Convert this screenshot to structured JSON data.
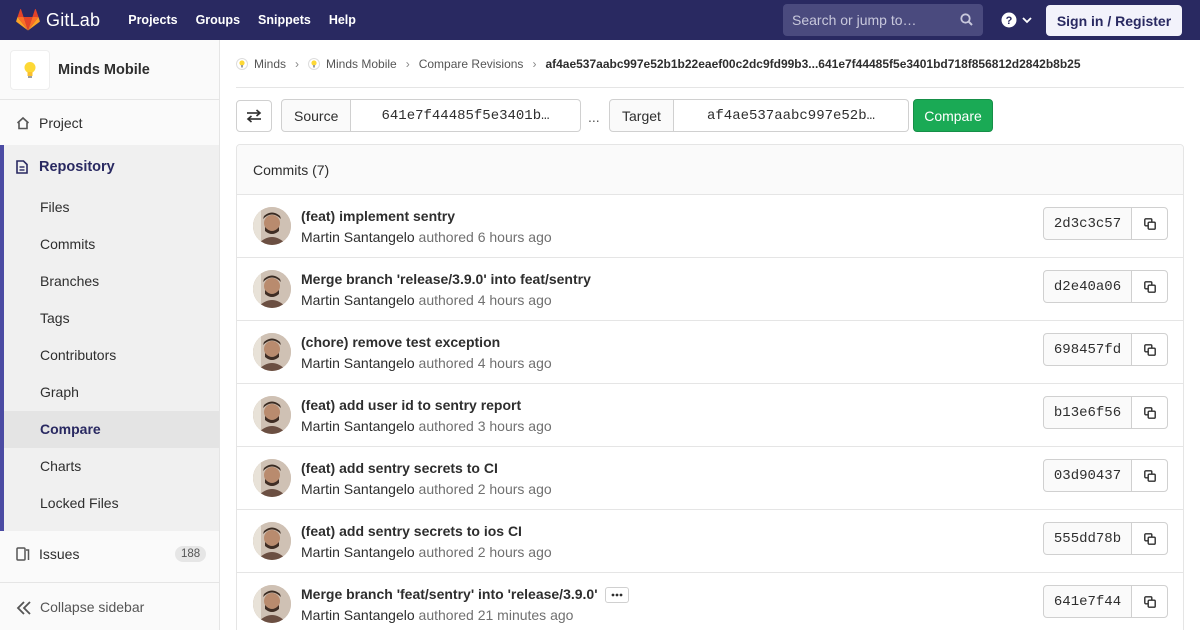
{
  "header": {
    "brand": "GitLab",
    "nav": [
      "Projects",
      "Groups",
      "Snippets",
      "Help"
    ],
    "search_placeholder": "Search or jump to…",
    "signin_label": "Sign in / Register"
  },
  "sidebar": {
    "project_name": "Minds Mobile",
    "project_label": "Project",
    "repository_label": "Repository",
    "repository_items": [
      "Files",
      "Commits",
      "Branches",
      "Tags",
      "Contributors",
      "Graph",
      "Compare",
      "Charts",
      "Locked Files"
    ],
    "active_item": "Compare",
    "issues_label": "Issues",
    "issues_count": "188",
    "collapse_label": "Collapse sidebar"
  },
  "breadcrumb": {
    "items": [
      "Minds",
      "Minds Mobile",
      "Compare Revisions"
    ],
    "current": "af4ae537aabc997e52b1b22eaef00c2dc9fd99b3...641e7f44485f5e3401bd718f856812d2842b8b25"
  },
  "compare": {
    "source_label": "Source",
    "source_value": "641e7f44485f5e3401b…",
    "separator": "...",
    "target_label": "Target",
    "target_value": "af4ae537aabc997e52b…",
    "button_label": "Compare"
  },
  "commits": {
    "header": "Commits (7)",
    "authored_word": "authored",
    "list": [
      {
        "title": "(feat) implement sentry",
        "author": "Martin Santangelo",
        "time": "6 hours ago",
        "sha": "2d3c3c57"
      },
      {
        "title": "Merge branch 'release/3.9.0' into feat/sentry",
        "author": "Martin Santangelo",
        "time": "4 hours ago",
        "sha": "d2e40a06"
      },
      {
        "title": "(chore) remove test exception",
        "author": "Martin Santangelo",
        "time": "4 hours ago",
        "sha": "698457fd"
      },
      {
        "title": "(feat) add user id to sentry report",
        "author": "Martin Santangelo",
        "time": "3 hours ago",
        "sha": "b13e6f56"
      },
      {
        "title": "(feat) add sentry secrets to CI",
        "author": "Martin Santangelo",
        "time": "2 hours ago",
        "sha": "03d90437"
      },
      {
        "title": "(feat) add sentry secrets to ios CI",
        "author": "Martin Santangelo",
        "time": "2 hours ago",
        "sha": "555dd78b"
      },
      {
        "title": "Merge branch 'feat/sentry' into 'release/3.9.0'",
        "author": "Martin Santangelo",
        "time": "21 minutes ago",
        "sha": "641e7f44"
      }
    ]
  },
  "colors": {
    "topbar": "#292961",
    "accent": "#4b4ba3",
    "compare_button": "#1aaa55"
  }
}
